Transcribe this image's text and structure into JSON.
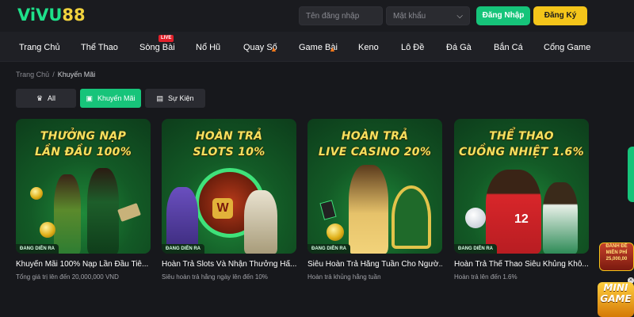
{
  "header": {
    "logo_part1": "ViVU",
    "logo_part2": "88",
    "username_placeholder": "Tên đăng nhập",
    "password_placeholder": "Mật khẩu",
    "login_label": "Đăng Nhập",
    "register_label": "Đăng Ký",
    "colors": {
      "primary_green": "#16c47a",
      "accent_yellow": "#f4c51a",
      "live_red": "#e2202a"
    }
  },
  "nav": {
    "items": [
      {
        "label": "Trang Chủ"
      },
      {
        "label": "Thể Thao"
      },
      {
        "label": "Sòng Bài",
        "badge": "LIVE"
      },
      {
        "label": "Nổ Hũ"
      },
      {
        "label": "Quay Số",
        "icon": "fire-icon"
      },
      {
        "label": "Game Bài",
        "icon": "fire-icon"
      },
      {
        "label": "Keno"
      },
      {
        "label": "Lô Đề"
      },
      {
        "label": "Đá Gà"
      },
      {
        "label": "Bắn Cá"
      },
      {
        "label": "Cổng Game"
      }
    ]
  },
  "breadcrumb": {
    "home": "Trang Chủ",
    "separator": "/",
    "current": "Khuyến Mãi"
  },
  "filters": {
    "all": {
      "label": "All",
      "icon": "crown-icon"
    },
    "promo": {
      "label": "Khuyến Mãi",
      "icon": "gift-icon",
      "active": true
    },
    "event": {
      "label": "Sự Kiện",
      "icon": "calendar-icon"
    }
  },
  "cards": [
    {
      "art_line1": "THƯỞNG NẠP",
      "art_line2": "LẦN ĐẦU 100%",
      "status": "ĐANG DIỄN RA",
      "title": "Khuyến Mãi 100% Nạp Lần Đầu Tiê...",
      "subtitle": "Tổng giá trị lên đến 20,000,000 VND"
    },
    {
      "art_line1": "HOÀN TRẢ",
      "art_line2": "SLOTS 10%",
      "status": "ĐANG DIỄN RA",
      "title": "Hoàn Trả Slots Và Nhận Thưởng Hấ...",
      "subtitle": "Siêu hoàn trả hằng ngày lên đến 10%"
    },
    {
      "art_line1": "HOÀN TRẢ",
      "art_line2": "LIVE CASINO 20%",
      "status": "ĐANG DIỄN RA",
      "title": "Siêu Hoàn Trả Hằng Tuần Cho Ngườ...",
      "subtitle": "Hoàn trả khủng hằng tuần"
    },
    {
      "art_line1": "THỂ THAO",
      "art_line2": "CUỒNG NHIỆT 1.6%",
      "status": "ĐANG DIỄN RA",
      "title": "Hoàn Trả Thể Thao Siêu Khủng Khô...",
      "subtitle": "Hoàn trả lên đến 1.6%"
    }
  ],
  "side_promo": {
    "top_line1": "ĐÁNH ĐỀ",
    "top_line2": "MIỄN PHÍ",
    "top_line3": "25,000,00",
    "bottom_line1": "MINI",
    "bottom_line2": "GAME"
  }
}
